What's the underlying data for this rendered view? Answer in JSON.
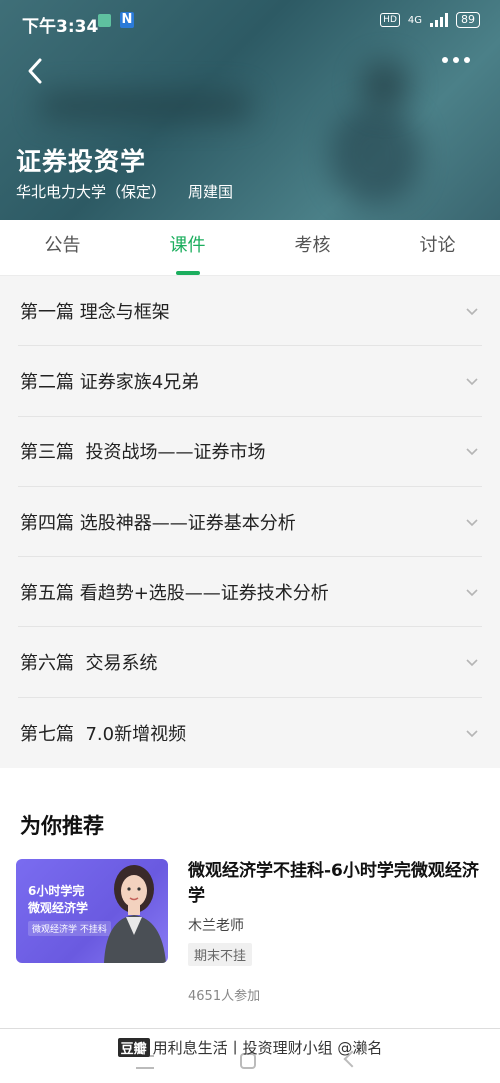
{
  "status_bar": {
    "time": "下午3:34",
    "hd": "HD",
    "network": "4G",
    "battery": "89"
  },
  "header": {
    "title": "证券投资学",
    "school": "华北电力大学（保定）",
    "teacher": "周建国"
  },
  "tabs": [
    {
      "label": "公告",
      "active": false
    },
    {
      "label": "课件",
      "active": true
    },
    {
      "label": "考核",
      "active": false
    },
    {
      "label": "讨论",
      "active": false
    }
  ],
  "chapters": [
    {
      "label": "第一篇 理念与框架"
    },
    {
      "label": "第二篇 证券家族4兄弟"
    },
    {
      "label": "第三篇  投资战场——证券市场"
    },
    {
      "label": "第四篇 选股神器——证券基本分析"
    },
    {
      "label": "第五篇 看趋势+选股——证券技术分析"
    },
    {
      "label": "第六篇  交易系统"
    },
    {
      "label": "第七篇  7.0新增视频"
    }
  ],
  "recommend": {
    "title": "为你推荐",
    "course": {
      "thumb_line1": "6小时学完",
      "thumb_line2": "微观经济学",
      "thumb_tag": "微观经济学 不挂科",
      "name": "微观经济学不挂科-6小时学完微观经济学",
      "teacher": "木兰老师",
      "badge": "期末不挂",
      "participants": "4651人参加"
    }
  },
  "watermark": {
    "logo": "豆瓣",
    "text": "用利息生活丨投资理财小组 @濑名"
  },
  "colors": {
    "accent": "#1cae5e",
    "header_bg": "#3f6f78",
    "thumb_bg": "#7a6cf0"
  }
}
